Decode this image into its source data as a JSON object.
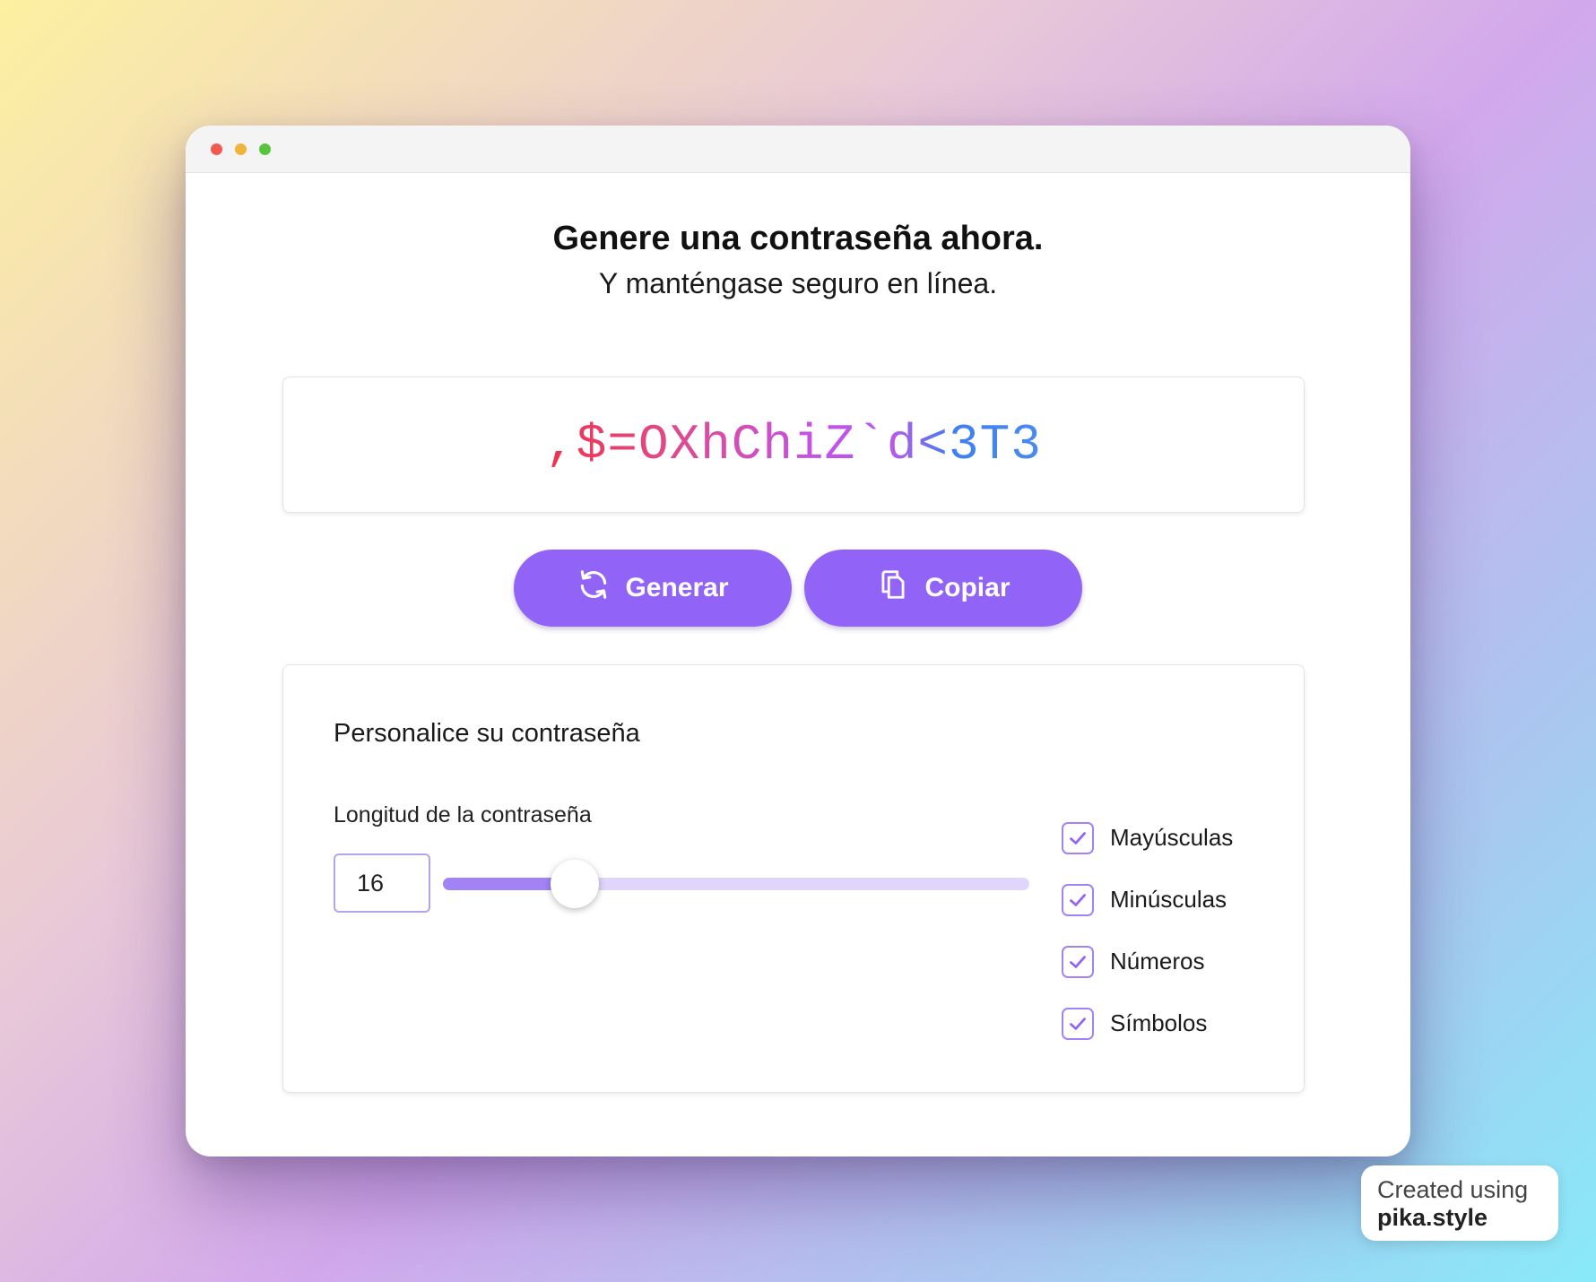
{
  "window": {
    "controls": [
      "close",
      "minimize",
      "maximize"
    ]
  },
  "header": {
    "title": "Genere una contraseña ahora.",
    "subtitle": "Y manténgase seguro en línea."
  },
  "password": {
    "value": ",$=OXhChiZ`d<3T3"
  },
  "actions": {
    "generate_label": "Generar",
    "generate_icon": "refresh-icon",
    "copy_label": "Copiar",
    "copy_icon": "copy-icon"
  },
  "settings": {
    "title": "Personalice su contraseña",
    "length_label": "Longitud de la contraseña",
    "length_value": "16",
    "slider_fraction": 0.225,
    "options": [
      {
        "label": "Mayúsculas",
        "checked": true
      },
      {
        "label": "Minúsculas",
        "checked": true
      },
      {
        "label": "Números",
        "checked": true
      },
      {
        "label": "Símbolos",
        "checked": true
      }
    ]
  },
  "watermark": {
    "line1": "Created using",
    "line2": "pika.style"
  },
  "colors": {
    "accent": "#9263f7",
    "checkbox_border": "#a283f5",
    "slider_track": "#e0d6fb"
  }
}
